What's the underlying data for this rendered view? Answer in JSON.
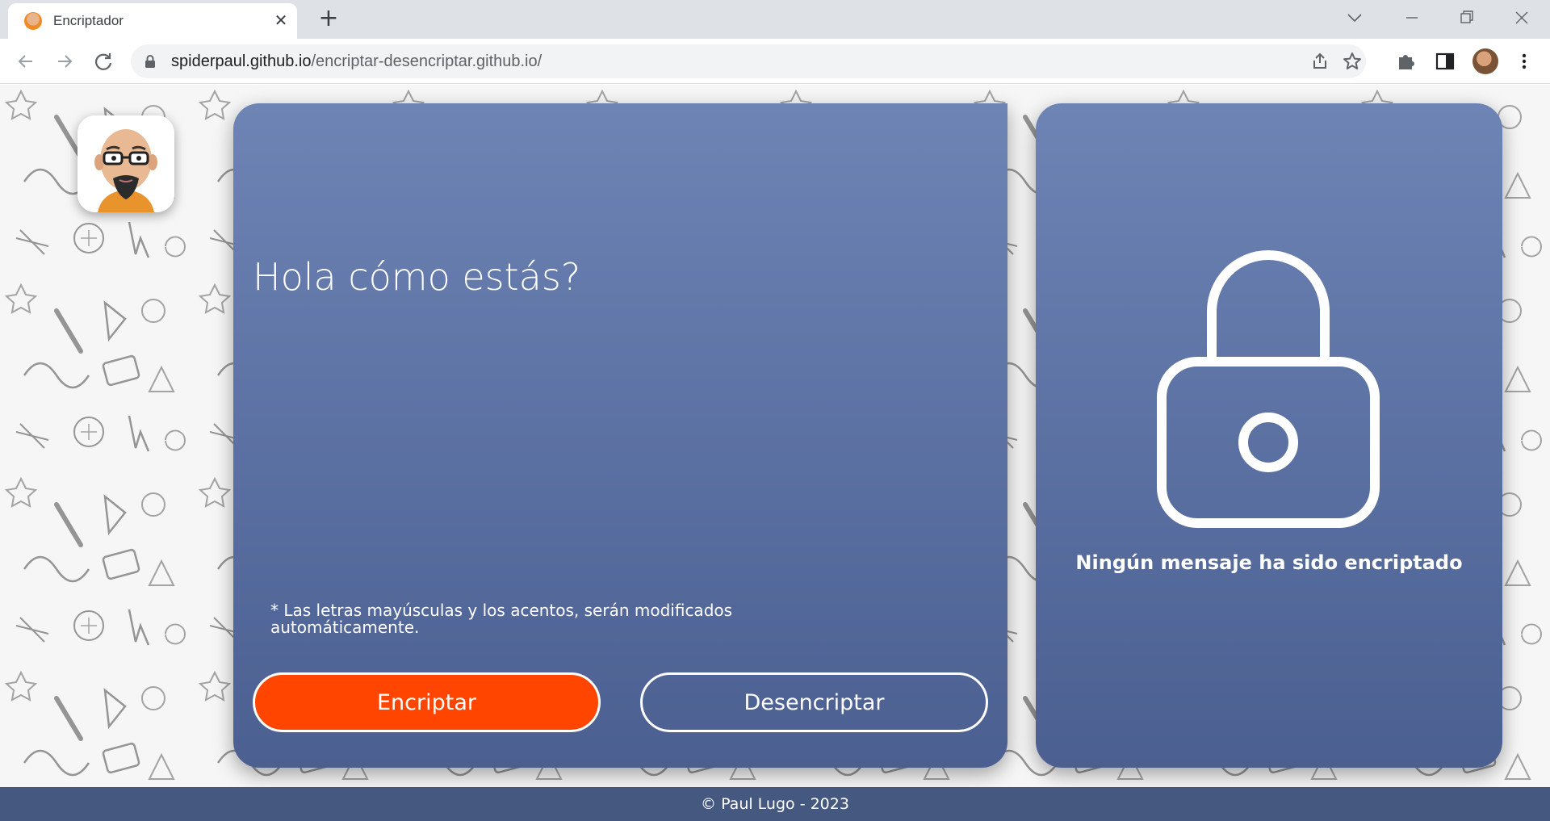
{
  "browser": {
    "tab_title": "Encriptador",
    "tab_close": "✕",
    "new_tab": "+",
    "url_host": "spiderpaul.github.io",
    "url_path": "/encriptar-desencriptar.github.io/"
  },
  "app": {
    "input_value": "Hola cómo estás?",
    "note": "* Las letras mayúsculas y los acentos, serán modificados automáticamente.",
    "encrypt_label": "Encriptar",
    "decrypt_label": "Desencriptar",
    "empty_message": "Ningún mensaje ha sido encriptado",
    "footer": "© Paul Lugo - 2023"
  },
  "colors": {
    "card_top": "#6d84b5",
    "card_bottom": "#4b5f91",
    "encrypt_button": "#ff4500",
    "footer_bg": "#45587f"
  },
  "icons": {
    "back": "arrow-left-icon",
    "forward": "arrow-right-icon",
    "reload": "reload-icon",
    "lock": "lock-icon",
    "share": "share-icon",
    "bookmark": "star-icon",
    "extensions": "puzzle-icon",
    "sidepanel": "side-panel-icon",
    "menu": "kebab-menu-icon",
    "padlock": "padlock-icon"
  }
}
